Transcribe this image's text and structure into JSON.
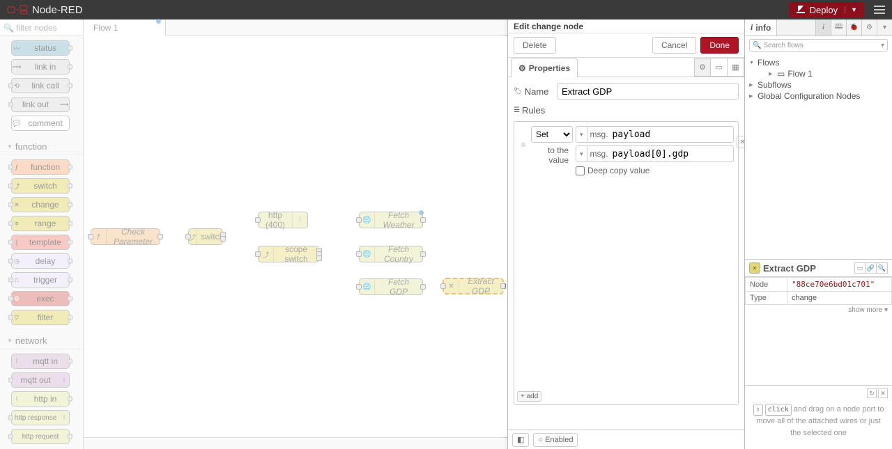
{
  "header": {
    "app_name": "Node-RED",
    "deploy_label": "Deploy"
  },
  "palette": {
    "filter_placeholder": "filter nodes",
    "categories": {
      "function": "function",
      "network": "network"
    },
    "nodes": {
      "status": "status",
      "link_in": "link in",
      "link_call": "link call",
      "link_out": "link out",
      "comment": "comment",
      "function": "function",
      "switch": "switch",
      "change": "change",
      "range": "range",
      "template": "template",
      "delay": "delay",
      "trigger": "trigger",
      "exec": "exec",
      "filter": "filter",
      "mqtt_in": "mqtt in",
      "mqtt_out": "mqtt out",
      "http_in": "http in",
      "http_response": "http response",
      "http_request": "http request"
    }
  },
  "workspace": {
    "tab_name": "Flow 1",
    "nodes": {
      "check_parameter": "Check Parameter",
      "switch": "switch",
      "http400": "http (400)",
      "scope_switch": "scope switch",
      "fetch_weather": "Fetch Weather",
      "fetch_country": "Fetch Country",
      "fetch_gdp": "Fetch GDP",
      "extract_gdp": "Extract GDP"
    }
  },
  "tray": {
    "title": "Edit change node",
    "delete_label": "Delete",
    "cancel_label": "Cancel",
    "done_label": "Done",
    "properties_label": "Properties",
    "name_label": "Name",
    "name_value": "Extract GDP",
    "rules_label": "Rules",
    "rule": {
      "op": "Set",
      "target_prefix": "msg.",
      "target_value": "payload",
      "to_label": "to the value",
      "source_prefix": "msg.",
      "source_value": "payload[0].gdp",
      "deep_copy_label": "Deep copy value"
    },
    "add_label": "+ add",
    "enabled_label": "Enabled"
  },
  "sidebar": {
    "info_label": "info",
    "search_placeholder": "Search flows",
    "tree": {
      "flows": "Flows",
      "flow1": "Flow 1",
      "subflows": "Subflows",
      "global": "Global Configuration Nodes"
    },
    "node": {
      "title": "Extract GDP",
      "node_k": "Node",
      "node_v": "\"88ce70e6bd01c701\"",
      "type_k": "Type",
      "type_v": "change",
      "show_more": "show more ▾"
    },
    "help_before": " and drag on a node port to move all of the attached wires or just the selected one",
    "help_key": "click"
  }
}
